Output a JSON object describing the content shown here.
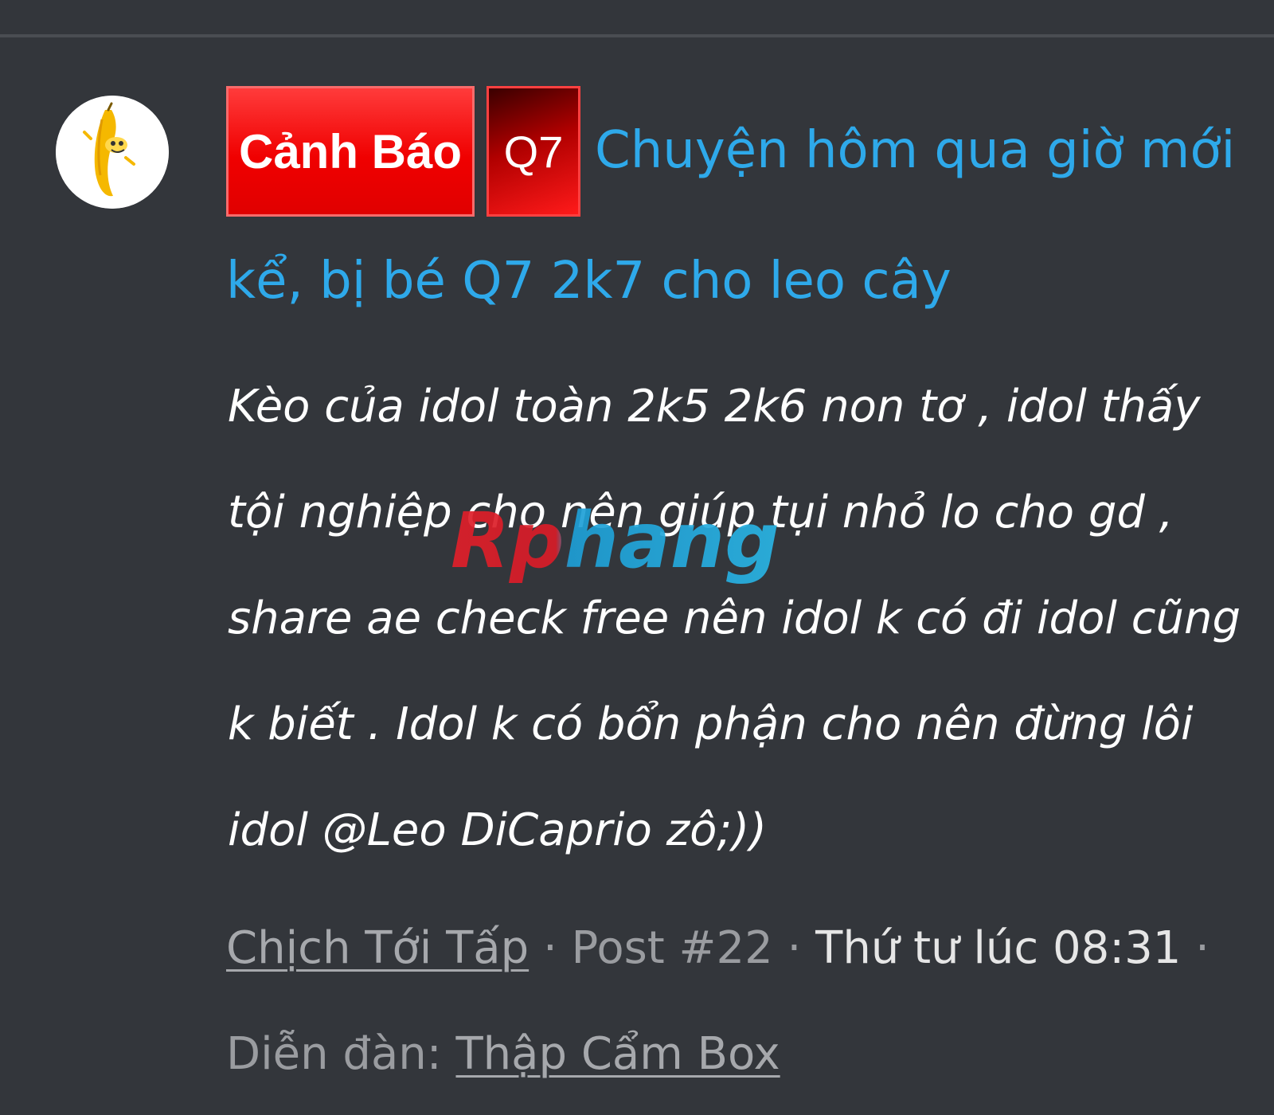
{
  "thread": {
    "prefix_warning": "Cảnh Báo",
    "prefix_location": "Q7",
    "title": "Chuyện hôm qua giờ mới kể, bị bé Q7 2k7 cho leo cây",
    "snippet": "Kèo của idol toàn 2k5 2k6 non tơ , idol thấy tội nghiệp cho nên giúp tụi nhỏ lo cho gd , share ae check free nên idol k có đi idol cũng k biết . Idol k có bổn phận cho nên đừng lôi idol @Leo DiCaprio zô;))",
    "meta": {
      "author": "Chịch Tới Tấp",
      "sep1": " · ",
      "post_number": "Post #22",
      "sep2": " · ",
      "date": "Thứ tư lúc 08:31",
      "sep3": " · ",
      "forum_label": "Diễn đàn: ",
      "forum_name": "Thập Cẩm Box"
    }
  },
  "watermark": {
    "text": "Rphang"
  },
  "colors": {
    "background": "#33363b",
    "link": "#2ea9ea",
    "warning_red": "#f00000",
    "muted_text": "#9a9ca0"
  },
  "icons": {
    "avatar": "banana-mascot-icon"
  }
}
